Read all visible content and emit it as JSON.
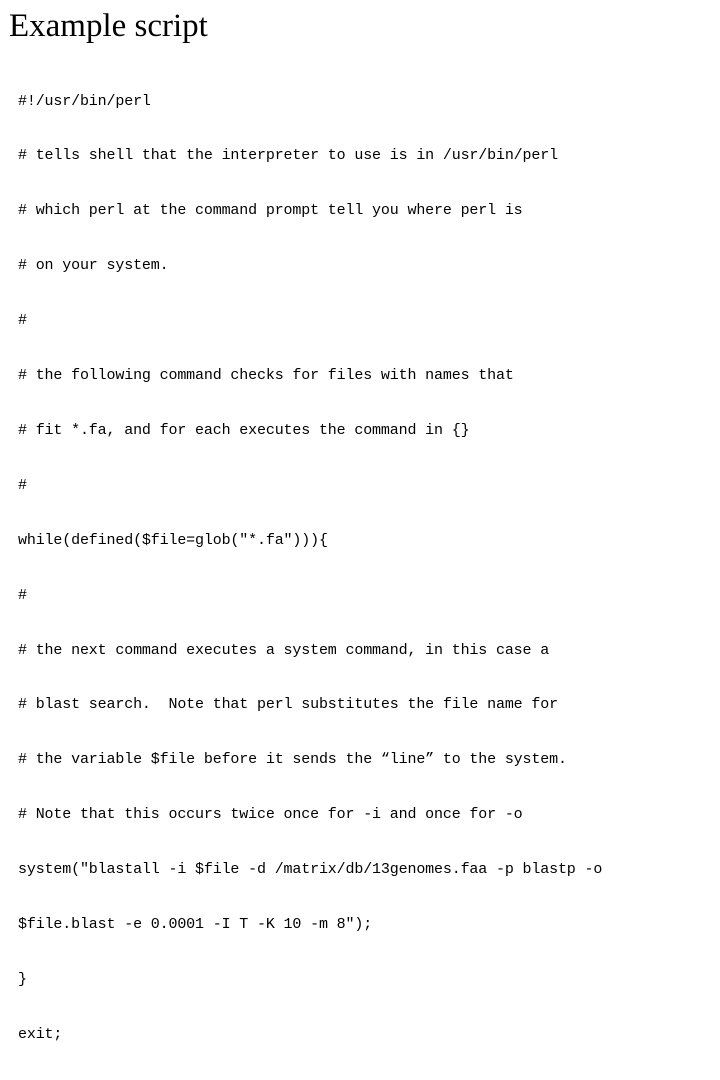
{
  "slide": {
    "title": "Example script",
    "background_color": "#ffffff",
    "text_color": "#000000"
  },
  "code": {
    "language": "perl",
    "lines": [
      "#!/usr/bin/perl",
      "# tells shell that the interpreter to use is in /usr/bin/perl",
      "# which perl at the command prompt tell you where perl is",
      "# on your system.",
      "#",
      "# the following command checks for files with names that",
      "# fit *.fa, and for each executes the command in {}",
      "#",
      "while(defined($file=glob(\"*.fa\"))){",
      "#",
      "# the next command executes a system command, in this case a",
      "# blast search.  Note that perl substitutes the file name for",
      "# the variable $file before it sends the “line” to the system.",
      "# Note that this occurs twice once for -i and once for -o",
      "system(\"blastall -i $file -d /matrix/db/13genomes.faa -p blastp -o",
      "$file.blast -e 0.0001 -I T -K 10 -m 8\");",
      "}",
      "exit;"
    ]
  }
}
